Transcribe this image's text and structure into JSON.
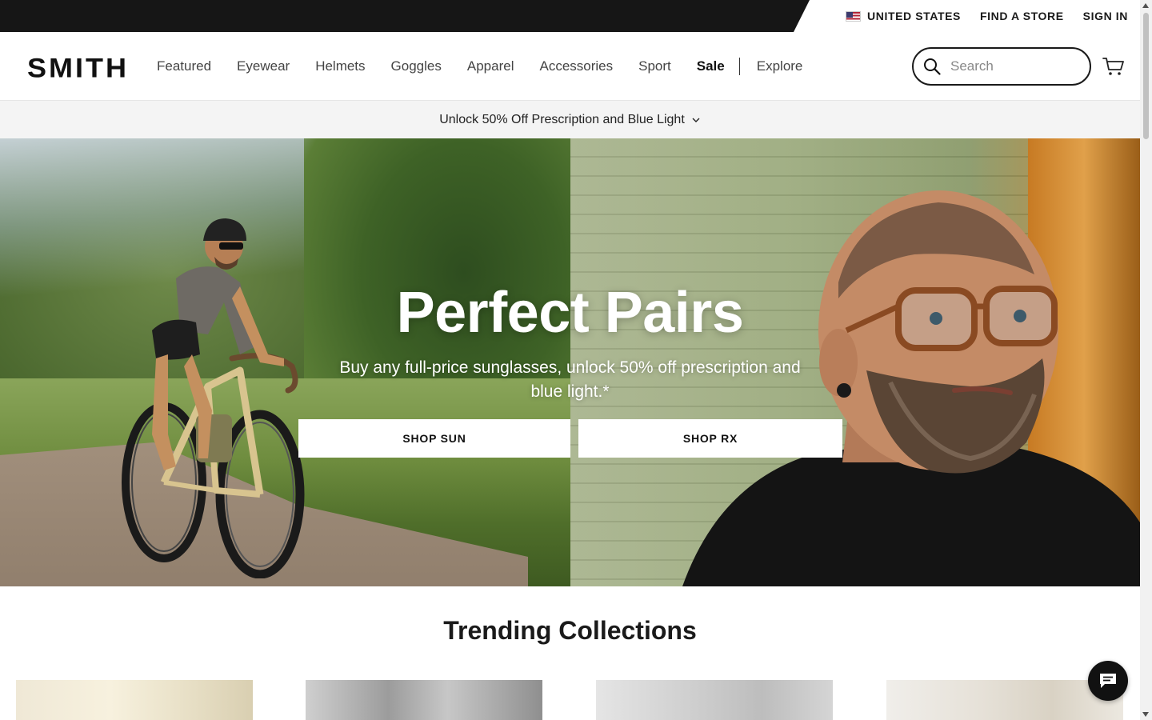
{
  "utility_bar": {
    "region_label": "UNITED STATES",
    "find_store_label": "FIND A STORE",
    "sign_in_label": "SIGN IN"
  },
  "header": {
    "logo_text": "SMITH",
    "nav_items": [
      "Featured",
      "Eyewear",
      "Helmets",
      "Goggles",
      "Apparel",
      "Accessories",
      "Sport",
      "Sale",
      "Explore"
    ],
    "search_placeholder": "Search"
  },
  "promo": {
    "text": "Unlock 50% Off Prescription and Blue Light"
  },
  "hero": {
    "title": "Perfect Pairs",
    "subtitle": "Buy any full-price sunglasses, unlock 50% off prescription and blue light.*",
    "buttons": {
      "shop_sun": "SHOP SUN",
      "shop_rx": "SHOP RX"
    }
  },
  "trending": {
    "title": "Trending Collections"
  },
  "colors": {
    "utility_dark": "#161616",
    "promo_bg": "#f4f4f4",
    "text_dark": "#1a1a1a"
  },
  "icons": [
    "us-flag-icon",
    "search-icon",
    "cart-icon",
    "chevron-down-icon",
    "chat-icon"
  ]
}
